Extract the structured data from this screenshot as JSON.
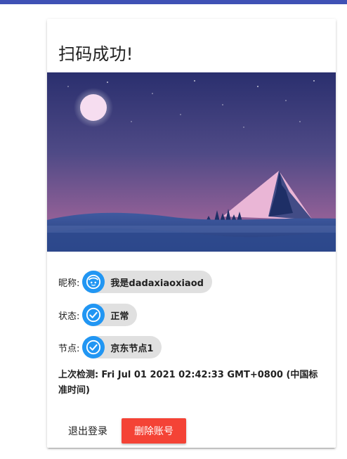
{
  "title": "扫码成功!",
  "nickname": {
    "label": "昵称:",
    "value": "我是dadaxiaoxiaod",
    "icon": "face-icon"
  },
  "status": {
    "label": "状态:",
    "value": "正常",
    "icon": "check-circle-icon"
  },
  "node": {
    "label": "节点:",
    "value": "京东节点1",
    "icon": "check-circle-icon"
  },
  "last_check": {
    "label": "上次检测:",
    "value": "Fri Jul 01 2021 02:42:33 GMT+0800 (中国标准时间)"
  },
  "actions": {
    "logout": "退出登录",
    "delete": "删除账号"
  },
  "colors": {
    "primary": "#3f51b5",
    "chip_avatar": "#2196f3",
    "danger": "#f44336",
    "chip_bg": "#e0e0e0"
  }
}
